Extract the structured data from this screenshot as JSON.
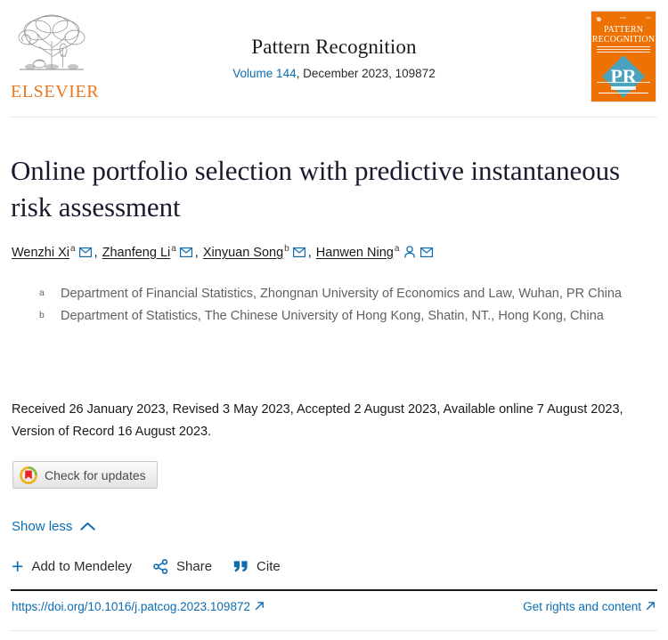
{
  "header": {
    "publisher_logo": "elsevier-logo",
    "publisher_name": "ELSEVIER",
    "journal_title": "Pattern Recognition",
    "volume_link": "Volume 144",
    "issue_meta": ", December 2023, 109872",
    "cover": {
      "line1": "PATTERN",
      "line2": "RECOGNITION",
      "monogram": "PR",
      "bg_color": "#ee7203",
      "diamond_color": "#4aa3bd"
    }
  },
  "article": {
    "title": "Online portfolio selection with predictive instantaneous risk assessment",
    "authors": [
      {
        "name": "Wenzhi Xi",
        "affiliation_mark": "a",
        "has_email": true,
        "has_person": false,
        "separator": ","
      },
      {
        "name": "Zhanfeng Li",
        "affiliation_mark": "a",
        "has_email": true,
        "has_person": false,
        "separator": ","
      },
      {
        "name": "Xinyuan Song",
        "affiliation_mark": "b",
        "has_email": true,
        "has_person": false,
        "separator": ","
      },
      {
        "name": "Hanwen Ning",
        "affiliation_mark": "a",
        "has_email": true,
        "has_person": true,
        "separator": ""
      }
    ],
    "affiliations": [
      {
        "mark": "a",
        "text": "Department of Financial Statistics, Zhongnan University of Economics and Law, Wuhan, PR China"
      },
      {
        "mark": "b",
        "text": "Department of Statistics, The Chinese University of Hong Kong, Shatin, NT., Hong Kong, China"
      }
    ],
    "dates": "Received 26 January 2023, Revised 3 May 2023, Accepted 2 August 2023, Available online 7 August 2023, Version of Record 16 August 2023."
  },
  "crossmark": {
    "label": "Check for updates",
    "icon": "crossmark-icon"
  },
  "toggle": {
    "label": "Show less",
    "icon": "chevron-up-icon"
  },
  "actions": [
    {
      "label": "Add to Mendeley",
      "icon": "plus-icon"
    },
    {
      "label": "Share",
      "icon": "share-nodes-icon"
    },
    {
      "label": "Cite",
      "icon": "quote-icon"
    }
  ],
  "footer": {
    "doi": "https://doi.org/10.1016/j.patcog.2023.109872",
    "doi_icon": "external-link-icon",
    "rights": "Get rights and content",
    "rights_icon": "external-link-icon"
  },
  "colors": {
    "link_blue": "#0b6cb2",
    "elsevier_orange": "#e87722",
    "cover_orange": "#ee7203",
    "affiliation_gray": "#616161"
  }
}
